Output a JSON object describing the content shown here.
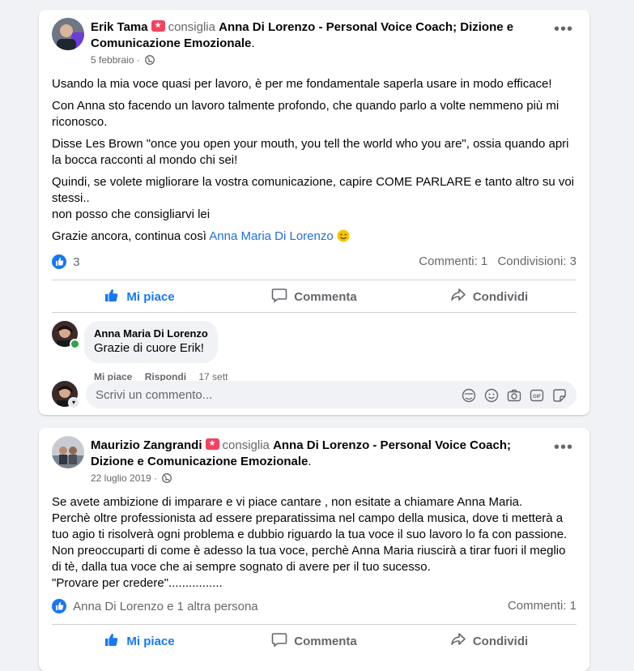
{
  "posts": [
    {
      "author": "Erik Tama",
      "verb": "consiglia",
      "page": "Anna Di Lorenzo - Personal Voice Coach; Dizione e Comunicazione Emozionale",
      "date": "5 febbraio",
      "paragraphs": [
        "Usando la mia voce quasi per lavoro, è per me fondamentale saperla usare in modo efficace!",
        "Con Anna sto facendo un lavoro talmente profondo, che quando parlo a volte nemmeno più mi riconosco.",
        "Disse Les Brown \"once you open your mouth, you tell the world who you are\", ossia quando apri la bocca racconti al mondo chi sei!",
        "Quindi, se volete migliorare la vostra comunicazione, capire COME PARLARE e tanto altro su voi stessi..",
        "non posso che consigliarvi lei"
      ],
      "thanks_text": "Grazie ancora, continua così ",
      "thanks_link": "Anna Maria Di Lorenzo",
      "likes": "3",
      "comments_count": "Commenti: 1",
      "shares_count": "Condivisioni: 3",
      "actions": {
        "like": "Mi piace",
        "comment": "Commenta",
        "share": "Condividi"
      },
      "comment": {
        "name": "Anna Maria Di Lorenzo",
        "text": "Grazie di cuore Erik!",
        "like": "Mi piace",
        "reply": "Rispondi",
        "time": "17 sett"
      },
      "write_placeholder": "Scrivi un commento..."
    },
    {
      "author": "Maurizio Zangrandi",
      "verb": "consiglia",
      "page": "Anna Di Lorenzo - Personal Voice Coach; Dizione e Comunicazione Emozionale",
      "date": "22 luglio 2019",
      "lines": [
        "Se avete ambizione di imparare e vi piace cantare , non esitate a chiamare Anna Maria.",
        "Perchè oltre professionista ad essere preparatissima nel campo della musica, dove ti metterà a tuo agio ti risolverà ogni problema e dubbio riguardo la tua voce il suo lavoro lo fa con passione.",
        "Non preoccuparti di come è adesso la tua voce, perchè Anna Maria riuscirà a tirar fuori il meglio di tè, dalla tua voce che ai sempre sognato di avere per il tuo sucesso.",
        "\"Provare per credere\"................"
      ],
      "likes": "Anna Di Lorenzo e 1 altra persona",
      "comments_count": "Commenti: 1",
      "actions": {
        "like": "Mi piace",
        "comment": "Commenta",
        "share": "Condividi"
      }
    }
  ],
  "colors": {
    "accent": "#1877f2",
    "link": "#216fdb",
    "badge": "#f3425f",
    "muted": "#65676b"
  }
}
